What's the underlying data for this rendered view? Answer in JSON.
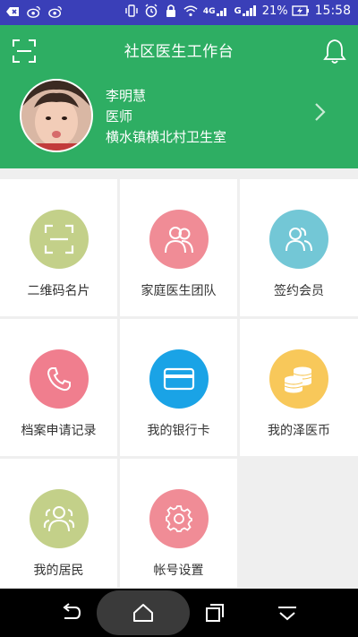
{
  "status_bar": {
    "battery_percent": "21%",
    "time": "15:58",
    "network_4g": "4G",
    "network_g": "G",
    "icons": [
      "back-arrow-icon",
      "weibo-icon",
      "weibo-icon",
      "vibrate-icon",
      "alarm-icon",
      "lock-icon",
      "wifi-icon",
      "signal-icon",
      "signal-icon",
      "battery-icon"
    ]
  },
  "header": {
    "title": "社区医生工作台",
    "name": "李明慧",
    "role": "医师",
    "organization": "横水镇横北村卫生室",
    "color": "#2eae63"
  },
  "grid": {
    "items": [
      {
        "label": "二维码名片",
        "icon": "qr-scan-icon",
        "color": "#c3d089"
      },
      {
        "label": "家庭医生团队",
        "icon": "doctors-team-icon",
        "color": "#f08c96"
      },
      {
        "label": "签约会员",
        "icon": "members-icon",
        "color": "#73c7d6"
      },
      {
        "label": "档案申请记录",
        "icon": "phone-icon",
        "color": "#f07e8e"
      },
      {
        "label": "我的银行卡",
        "icon": "bank-card-icon",
        "color": "#1aa3e6"
      },
      {
        "label": "我的泽医币",
        "icon": "coins-icon",
        "color": "#f8c85a"
      },
      {
        "label": "我的居民",
        "icon": "residents-icon",
        "color": "#c3d089"
      },
      {
        "label": "帐号设置",
        "icon": "gear-icon",
        "color": "#f08c96"
      }
    ]
  },
  "nav": {
    "icons": [
      "back-icon",
      "home-icon",
      "recent-apps-icon",
      "menu-down-icon"
    ]
  }
}
